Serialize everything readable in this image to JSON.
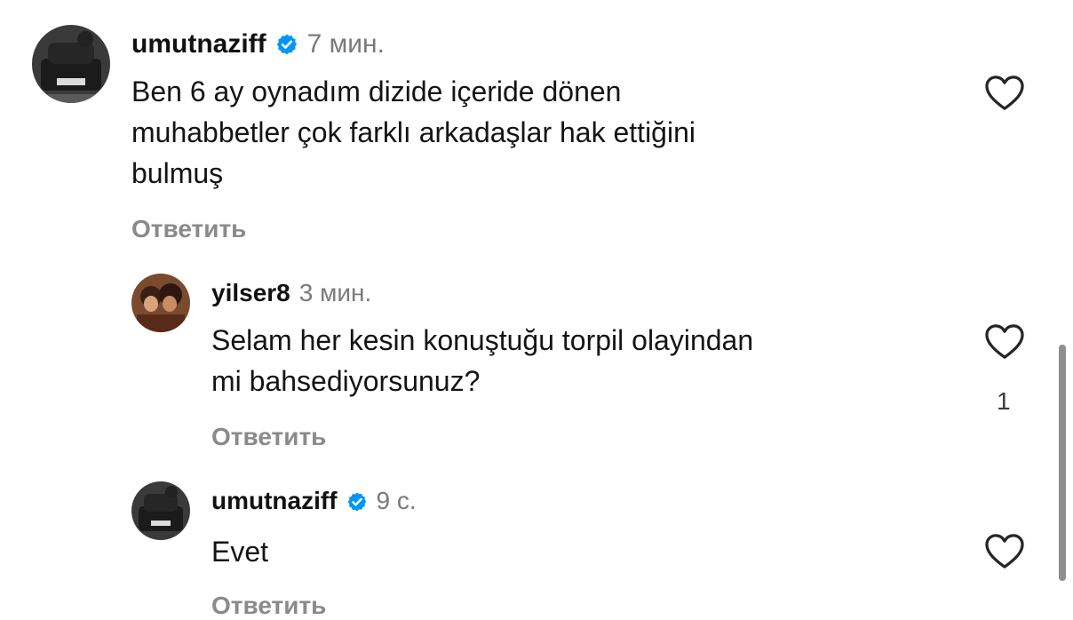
{
  "comments": [
    {
      "username": "umutnaziff",
      "verified": true,
      "time": "7 мин.",
      "text_lines": [
        "Ben 6 ay oynadım dizide içeride dönen",
        "muhabbetler çok farklı arkadaşlar hak ettiğini",
        "bulmuş"
      ],
      "reply_label": "Ответить"
    },
    {
      "username": "yilser8",
      "verified": false,
      "time": "3 мин.",
      "text_lines": [
        "Selam her kesin konuştuğu torpil olayindan",
        "mi bahsediyorsunuz?"
      ],
      "like_count": "1",
      "reply_label": "Ответить"
    },
    {
      "username": "umutnaziff",
      "verified": true,
      "time": "9 с.",
      "text_lines": [
        "Evet"
      ],
      "reply_label": "Ответить"
    }
  ],
  "icons": {
    "like": "heart-outline-icon",
    "verified": "verified-badge-icon"
  },
  "colors": {
    "verified_blue": "#0095f6",
    "username": "#111111",
    "muted": "#8a8a8a",
    "heart_stroke": "#262626"
  }
}
